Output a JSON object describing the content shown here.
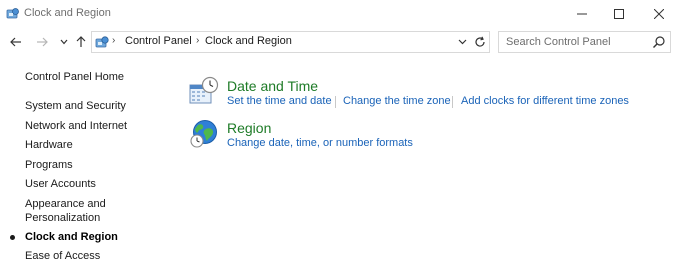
{
  "window": {
    "title": "Clock and Region",
    "icon": "control-panel-icon",
    "controls": [
      "minimize-icon",
      "maximize-icon",
      "close-icon"
    ]
  },
  "navigation": {
    "back": "back-arrow-icon",
    "forward": "forward-arrow-icon",
    "recent": "chevron-down-icon",
    "up": "up-arrow-icon"
  },
  "address_bar": {
    "icon": "control-panel-icon",
    "breadcrumbs": [
      "Control Panel",
      "Clock and Region"
    ],
    "separator": "›",
    "dropdown_icon": "chevron-down-icon",
    "refresh_icon": "refresh-icon"
  },
  "search": {
    "placeholder": "Search Control Panel",
    "icon": "search-icon"
  },
  "sidebar": {
    "home": "Control Panel Home",
    "items": [
      "System and Security",
      "Network and Internet",
      "Hardware",
      "Programs",
      "User Accounts",
      "Appearance and",
      "Personalization",
      "Clock and Region",
      "Ease of Access"
    ],
    "active_item": "Clock and Region"
  },
  "sections": [
    {
      "title": "Date and Time",
      "icon": "date-time-icon",
      "links": [
        "Set the time and date",
        "Change the time zone",
        "Add clocks for different time zones"
      ]
    },
    {
      "title": "Region",
      "icon": "region-globe-icon",
      "links": [
        "Change date, time, or number formats"
      ]
    }
  ],
  "colors": {
    "section_title": "#1e7b27",
    "link": "#1a63b8",
    "text": "#1b1b1b",
    "border": "#d9d9d9"
  }
}
